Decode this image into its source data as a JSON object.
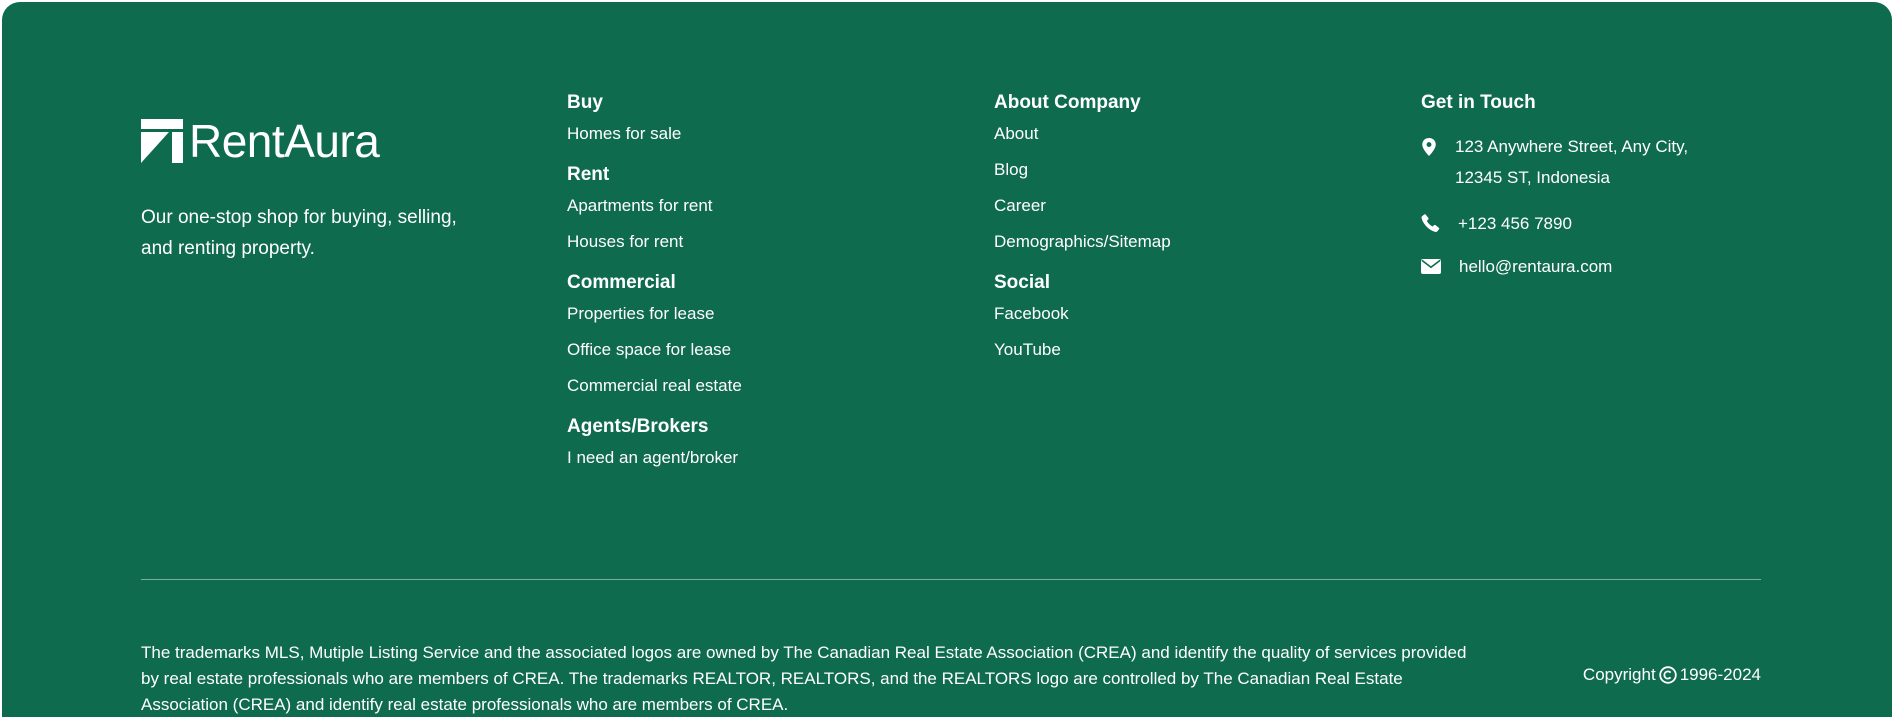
{
  "brand": {
    "name": "RentAura",
    "tagline": "Our one-stop shop for buying, selling, and renting property."
  },
  "col_buy": {
    "groups": [
      {
        "heading": "Buy",
        "links": [
          "Homes for sale"
        ]
      },
      {
        "heading": "Rent",
        "links": [
          "Apartments for rent",
          "Houses for rent"
        ]
      },
      {
        "heading": "Commercial",
        "links": [
          "Properties for lease",
          "Office space for lease",
          "Commercial real estate"
        ]
      },
      {
        "heading": "Agents/Brokers",
        "links": [
          "I need an agent/broker"
        ]
      }
    ]
  },
  "col_company": {
    "groups": [
      {
        "heading": "About Company",
        "links": [
          "About",
          "Blog",
          "Career",
          "Demographics/Sitemap"
        ]
      },
      {
        "heading": "Social",
        "links": [
          "Facebook",
          "YouTube"
        ]
      }
    ]
  },
  "contact": {
    "heading": "Get in Touch",
    "address": "123 Anywhere Street, Any City, 12345 ST, Indonesia",
    "phone": "+123 456 7890",
    "email": "hello@rentaura.com"
  },
  "legal": "The trademarks MLS, Mutiple Listing Service and the associated logos are owned by The Canadian Real Estate Association (CREA) and identify the quality of services provided by real estate professionals who are members of CREA. The trademarks REALTOR, REALTORS, and the REALTORS logo are controlled by The Canadian Real Estate Association (CREA) and identify real estate professionals who are members of CREA.",
  "copyright": {
    "prefix": "Copyright",
    "years": "1996-2024"
  },
  "colors": {
    "background": "#0f6b4d",
    "text": "#ffffff"
  },
  "icons": {
    "logo": "rentaura-logo-icon",
    "address": "map-pin-icon",
    "phone": "phone-icon",
    "email": "envelope-icon",
    "copyright": "copyright-icon"
  }
}
